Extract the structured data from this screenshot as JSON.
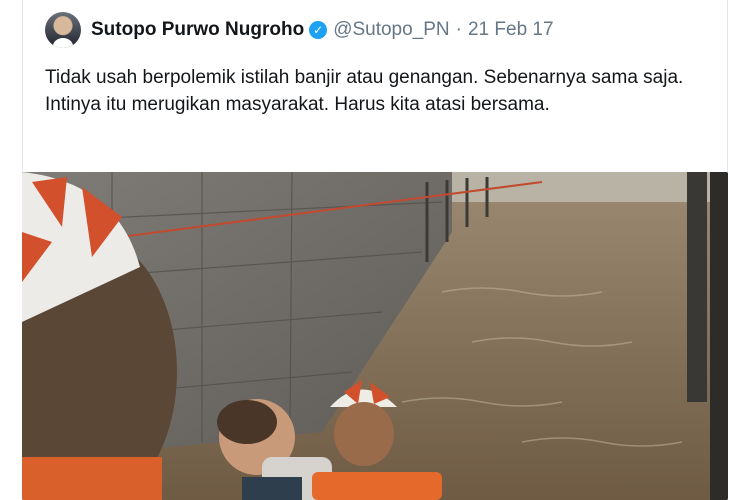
{
  "tweet": {
    "author": {
      "display_name": "Sutopo Purwo Nugroho",
      "handle": "@Sutopo_PN",
      "verified": true
    },
    "separator": "·",
    "date": "21 Feb 17",
    "text": "Tidak usah berpolemik istilah banjir atau genangan. Sebenarnya sama saja. Intinya itu merugikan masyarakat. Harus kita atasi bersama."
  },
  "icons": {
    "verified": "verified-badge-icon"
  },
  "colors": {
    "verified_blue": "#1da1f2",
    "name_text": "#14171a",
    "meta_text": "#657786"
  }
}
